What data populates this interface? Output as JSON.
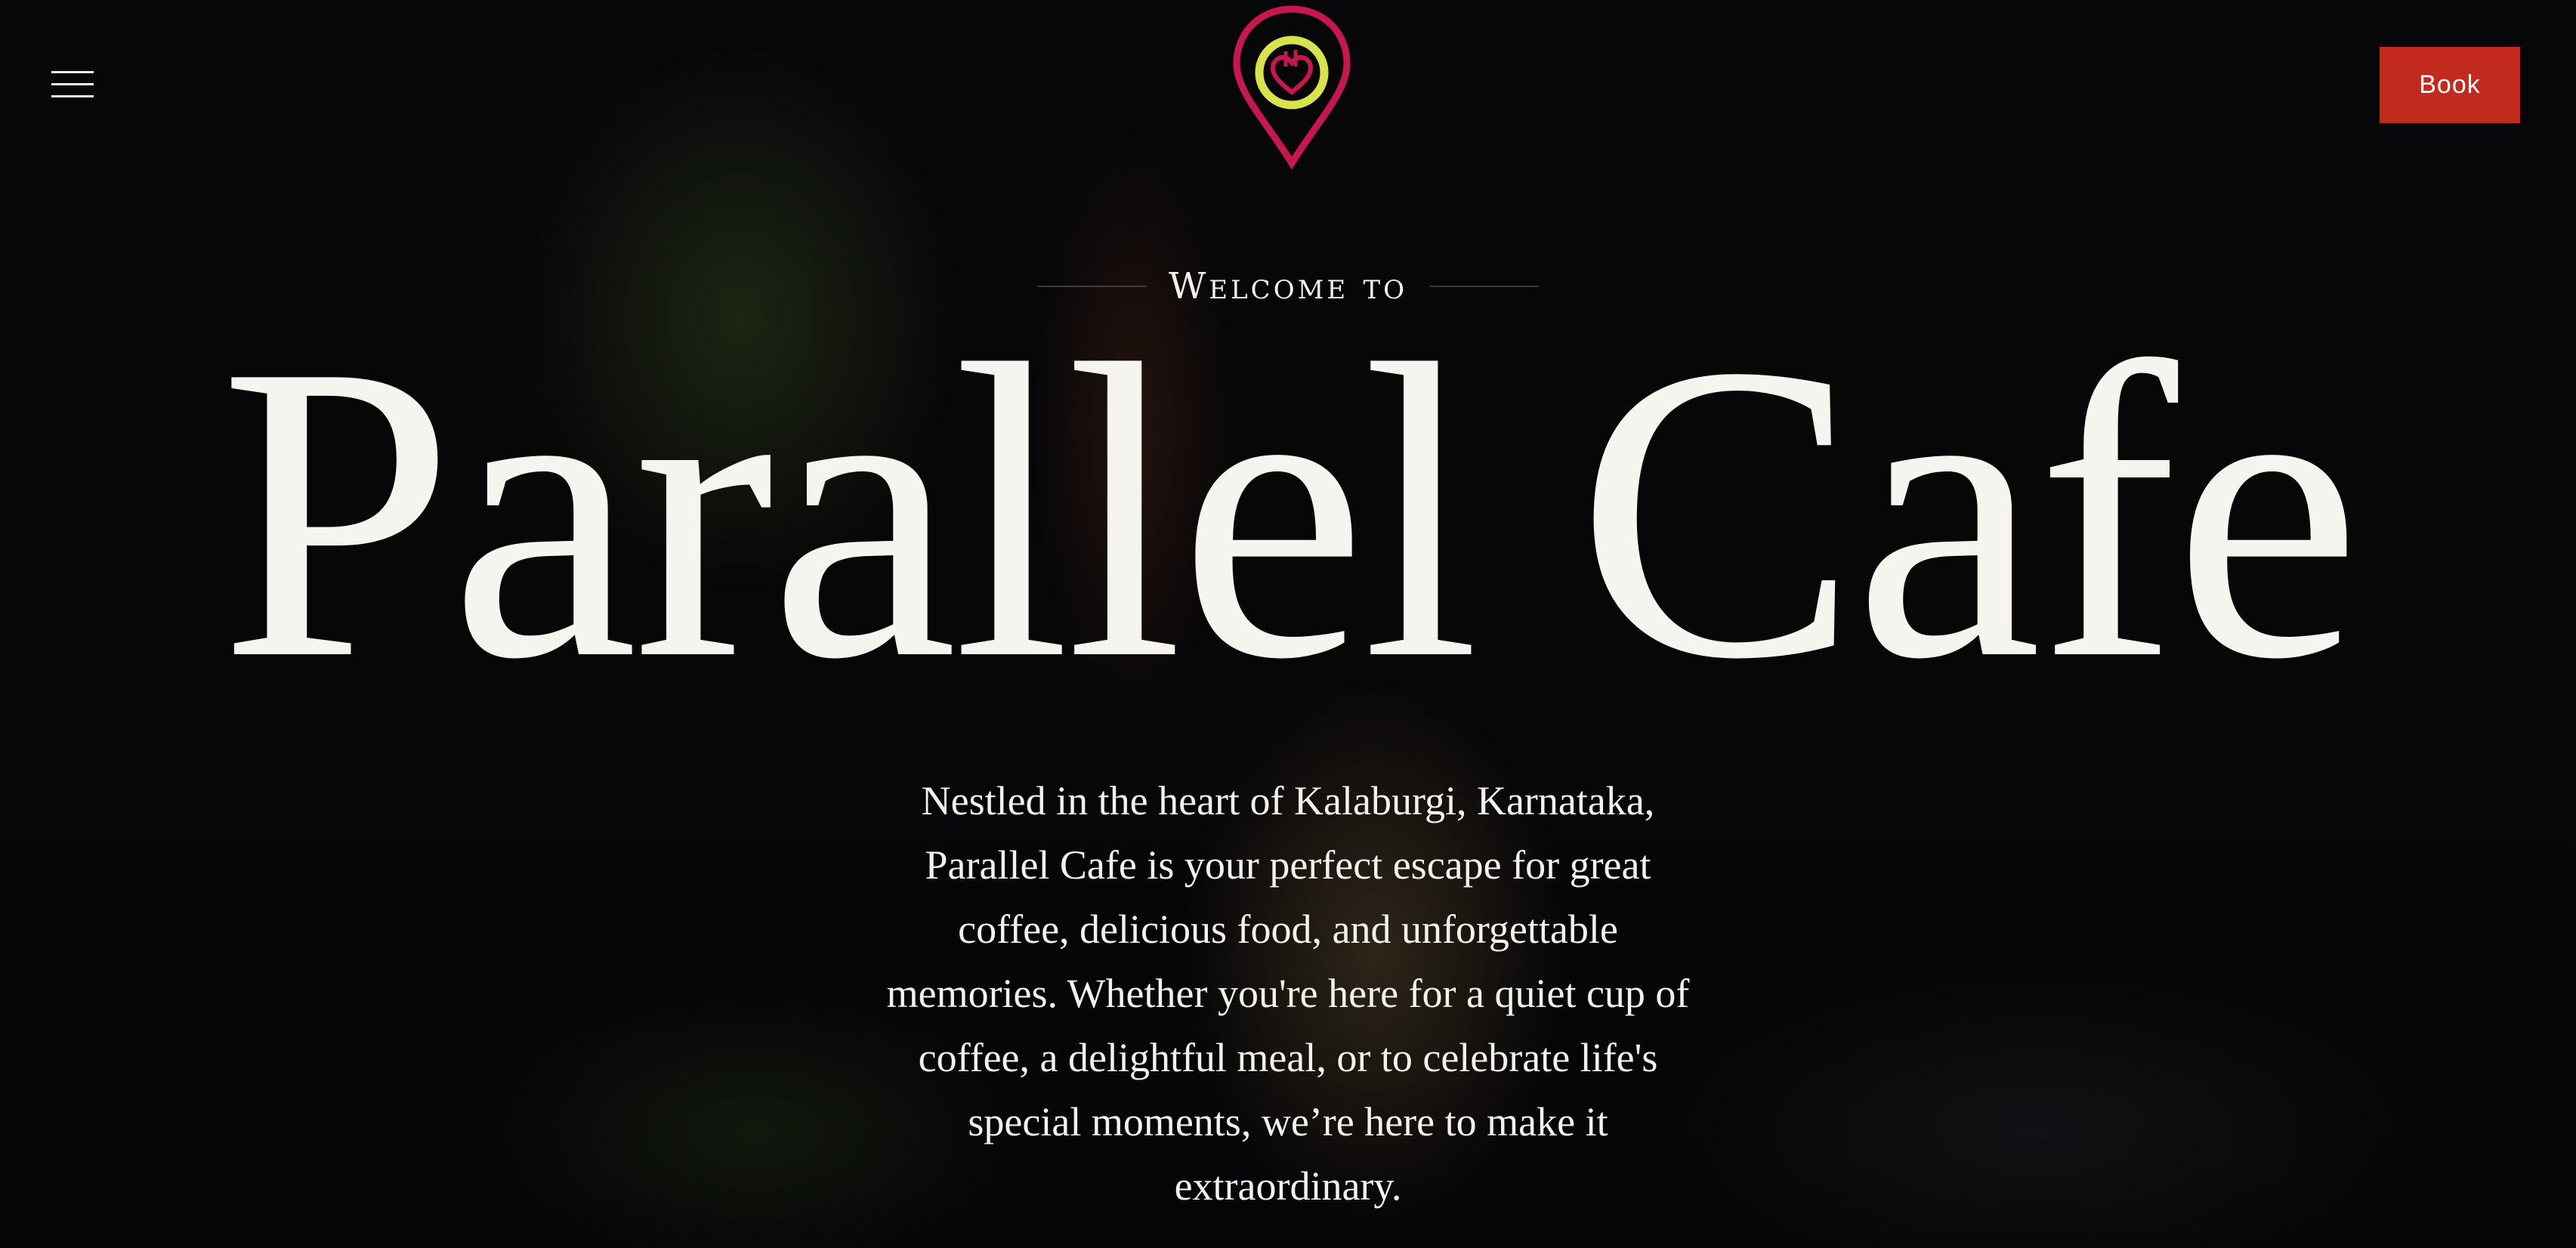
{
  "header": {
    "menu_icon": "hamburger-icon",
    "logo_icon": "map-pin-heart-icon",
    "book_label": "Book"
  },
  "hero": {
    "eyebrow": "Welcome to",
    "title": "Parallel Cafe",
    "description": "Nestled in the heart of Kalaburgi, Karnataka, Parallel Cafe is your perfect escape for great coffee, delicious food, and unforgettable memories. Whether you're here for a quiet cup of coffee, a delightful meal, or to celebrate life's special moments, we’re here to make it extraordinary."
  },
  "colors": {
    "accent": "#c12a1c",
    "logo_pin": "#c8174f",
    "logo_ring": "#d8e24a",
    "text": "#f3f1ec"
  }
}
